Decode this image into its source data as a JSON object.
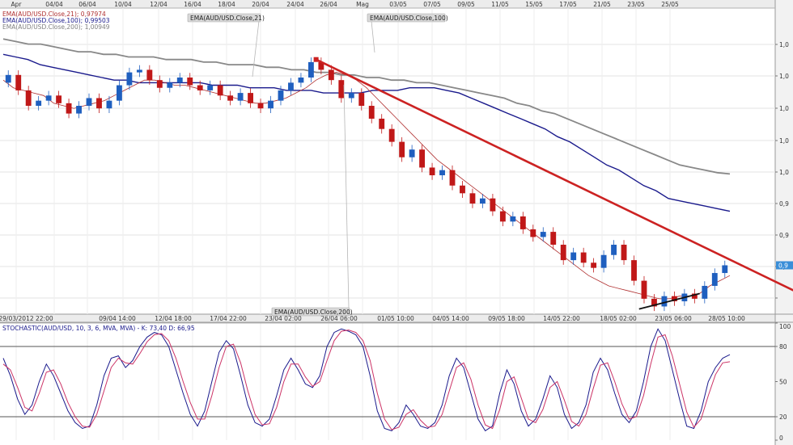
{
  "chart_data": [
    {
      "type": "candlestick",
      "symbol": "AUD/USD",
      "legend": [
        {
          "label": "EMA(AUD/USD.Close,21); 0,97974",
          "color": "#b03030"
        },
        {
          "label": "EMA(AUD/USD.Close,100); 0,99503",
          "color": "#1a1a8c"
        },
        {
          "label": "EMA(AUD/USD.Close,200); 1,00949",
          "color": "#808080"
        }
      ],
      "callouts": [
        "EMA(AUD/USD.Close,21)",
        "EMA(AUD/USD.Close,100)",
        "EMA(AUD/USD.Close,200)"
      ],
      "top_date_labels": [
        "Apr",
        "04/04",
        "06/04",
        "10/04",
        "12/04",
        "16/04",
        "18/04",
        "20/04",
        "24/04",
        "26/04",
        "Mag",
        "03/05",
        "07/05",
        "09/05",
        "11/05",
        "15/05",
        "17/05",
        "21/05",
        "23/05",
        "25/05"
      ],
      "bottom_date_labels": [
        "29/03/2012 22:00",
        "09/04 14:00",
        "12/04 18:00",
        "17/04 22:00",
        "23/04 02:00",
        "26/04 06:00",
        "01/05 10:00",
        "04/05 14:00",
        "09/05 18:00",
        "14/05 22:00",
        "18/05 02:00",
        "23/05 06:00",
        "28/05 10:00"
      ],
      "y_tick_labels": [
        "1,0",
        "1,0",
        "1,0",
        "1,0",
        "1,0",
        "0,9",
        "0,9",
        "0,9"
      ],
      "last_price_tag": "0,9",
      "ema": {
        "ema21": [
          1.046,
          1.043,
          1.042,
          1.041,
          1.04,
          1.037,
          1.036,
          1.035,
          1.036,
          1.037,
          1.038,
          1.04,
          1.042,
          1.044,
          1.046,
          1.046,
          1.045,
          1.044,
          1.044,
          1.043,
          1.042,
          1.041,
          1.04,
          1.039,
          1.038,
          1.037,
          1.037,
          1.038,
          1.039,
          1.041,
          1.043,
          1.046,
          1.048,
          1.049,
          1.048,
          1.046,
          1.043,
          1.039,
          1.035,
          1.031,
          1.027,
          1.023,
          1.019,
          1.015,
          1.012,
          1.009,
          1.006,
          1.003,
          1.0,
          0.997,
          0.994,
          0.991,
          0.988,
          0.985,
          0.982,
          0.979,
          0.976,
          0.973,
          0.97,
          0.968,
          0.966,
          0.965,
          0.964,
          0.963,
          0.962,
          0.961,
          0.961,
          0.962,
          0.962,
          0.963,
          0.966,
          0.968,
          0.97
        ],
        "ema100": [
          1.056,
          1.055,
          1.054,
          1.052,
          1.051,
          1.05,
          1.049,
          1.048,
          1.047,
          1.046,
          1.046,
          1.045,
          1.045,
          1.045,
          1.045,
          1.045,
          1.045,
          1.044,
          1.044,
          1.044,
          1.043,
          1.043,
          1.043,
          1.042,
          1.042,
          1.042,
          1.041,
          1.041,
          1.041,
          1.041,
          1.042,
          1.042,
          1.042,
          1.043,
          1.043,
          1.043,
          1.042,
          1.041,
          1.039,
          1.037,
          1.035,
          1.033,
          1.031,
          1.029,
          1.027,
          1.024,
          1.022,
          1.019,
          1.016,
          1.013,
          1.011,
          1.008,
          1.005,
          1.003,
          1.0,
          0.999,
          0.998,
          0.997,
          0.996,
          0.995
        ],
        "ema200": [
          1.062,
          1.061,
          1.06,
          1.06,
          1.059,
          1.058,
          1.057,
          1.057,
          1.056,
          1.056,
          1.055,
          1.055,
          1.055,
          1.054,
          1.054,
          1.054,
          1.053,
          1.053,
          1.052,
          1.052,
          1.052,
          1.051,
          1.051,
          1.05,
          1.05,
          1.049,
          1.049,
          1.048,
          1.048,
          1.047,
          1.047,
          1.046,
          1.046,
          1.045,
          1.045,
          1.044,
          1.043,
          1.042,
          1.041,
          1.04,
          1.039,
          1.037,
          1.036,
          1.034,
          1.033,
          1.031,
          1.029,
          1.027,
          1.025,
          1.023,
          1.021,
          1.019,
          1.017,
          1.015,
          1.013,
          1.012,
          1.011,
          1.01,
          1.0095
        ]
      },
      "candles": [
        {
          "o": 1.045,
          "c": 1.048
        },
        {
          "o": 1.048,
          "c": 1.042
        },
        {
          "o": 1.042,
          "c": 1.036
        },
        {
          "o": 1.036,
          "c": 1.038
        },
        {
          "o": 1.038,
          "c": 1.04
        },
        {
          "o": 1.04,
          "c": 1.037
        },
        {
          "o": 1.037,
          "c": 1.033
        },
        {
          "o": 1.033,
          "c": 1.036
        },
        {
          "o": 1.036,
          "c": 1.039
        },
        {
          "o": 1.039,
          "c": 1.035
        },
        {
          "o": 1.035,
          "c": 1.038
        },
        {
          "o": 1.038,
          "c": 1.044
        },
        {
          "o": 1.044,
          "c": 1.049
        },
        {
          "o": 1.049,
          "c": 1.05
        },
        {
          "o": 1.05,
          "c": 1.046
        },
        {
          "o": 1.046,
          "c": 1.043
        },
        {
          "o": 1.043,
          "c": 1.045
        },
        {
          "o": 1.045,
          "c": 1.047
        },
        {
          "o": 1.047,
          "c": 1.044
        },
        {
          "o": 1.044,
          "c": 1.042
        },
        {
          "o": 1.042,
          "c": 1.044
        },
        {
          "o": 1.044,
          "c": 1.04
        },
        {
          "o": 1.04,
          "c": 1.038
        },
        {
          "o": 1.038,
          "c": 1.041
        },
        {
          "o": 1.041,
          "c": 1.037
        },
        {
          "o": 1.037,
          "c": 1.035
        },
        {
          "o": 1.035,
          "c": 1.038
        },
        {
          "o": 1.038,
          "c": 1.042
        },
        {
          "o": 1.042,
          "c": 1.045
        },
        {
          "o": 1.045,
          "c": 1.047
        },
        {
          "o": 1.047,
          "c": 1.053
        },
        {
          "o": 1.053,
          "c": 1.05
        },
        {
          "o": 1.05,
          "c": 1.046
        },
        {
          "o": 1.046,
          "c": 1.039
        },
        {
          "o": 1.039,
          "c": 1.041
        },
        {
          "o": 1.041,
          "c": 1.036
        },
        {
          "o": 1.036,
          "c": 1.031
        },
        {
          "o": 1.031,
          "c": 1.027
        },
        {
          "o": 1.027,
          "c": 1.022
        },
        {
          "o": 1.022,
          "c": 1.016
        },
        {
          "o": 1.016,
          "c": 1.019
        },
        {
          "o": 1.019,
          "c": 1.012
        },
        {
          "o": 1.012,
          "c": 1.009
        },
        {
          "o": 1.009,
          "c": 1.011
        },
        {
          "o": 1.011,
          "c": 1.005
        },
        {
          "o": 1.005,
          "c": 1.002
        },
        {
          "o": 1.002,
          "c": 0.998
        },
        {
          "o": 0.998,
          "c": 1.0
        },
        {
          "o": 1.0,
          "c": 0.995
        },
        {
          "o": 0.995,
          "c": 0.991
        },
        {
          "o": 0.991,
          "c": 0.993
        },
        {
          "o": 0.993,
          "c": 0.988
        },
        {
          "o": 0.988,
          "c": 0.985
        },
        {
          "o": 0.985,
          "c": 0.987
        },
        {
          "o": 0.987,
          "c": 0.982
        },
        {
          "o": 0.982,
          "c": 0.976
        },
        {
          "o": 0.976,
          "c": 0.979
        },
        {
          "o": 0.979,
          "c": 0.975
        },
        {
          "o": 0.975,
          "c": 0.973
        },
        {
          "o": 0.973,
          "c": 0.978
        },
        {
          "o": 0.978,
          "c": 0.982
        },
        {
          "o": 0.982,
          "c": 0.976
        },
        {
          "o": 0.976,
          "c": 0.968
        },
        {
          "o": 0.968,
          "c": 0.961
        },
        {
          "o": 0.961,
          "c": 0.958
        },
        {
          "o": 0.958,
          "c": 0.962
        },
        {
          "o": 0.962,
          "c": 0.96
        },
        {
          "o": 0.96,
          "c": 0.963
        },
        {
          "o": 0.963,
          "c": 0.961
        },
        {
          "o": 0.961,
          "c": 0.966
        },
        {
          "o": 0.966,
          "c": 0.971
        },
        {
          "o": 0.971,
          "c": 0.974
        }
      ],
      "trendlines": [
        {
          "color": "#cc2222",
          "from": {
            "i": 30.5,
            "v": 1.054
          },
          "to": {
            "i": 79.5,
            "v": 0.961
          }
        },
        {
          "color": "#111111",
          "from": {
            "i": 62.5,
            "v": 0.957
          },
          "to": {
            "i": 68.5,
            "v": 0.963
          }
        }
      ],
      "ylim": [
        0.955,
        1.074
      ]
    },
    {
      "type": "line",
      "title": "STOCHASTIC(AUD/USD, 10, 3, 6, MVA, MVA) - K: 73,40  D: 66,95",
      "y_tick_labels": [
        "100",
        "80",
        "50",
        "20",
        "0"
      ],
      "ylim": [
        0,
        100
      ],
      "levels": [
        80,
        20
      ],
      "series": [
        {
          "name": "K",
          "color": "#1a1a8c",
          "values": [
            70,
            55,
            35,
            22,
            30,
            50,
            65,
            55,
            40,
            25,
            15,
            10,
            12,
            30,
            55,
            70,
            72,
            62,
            68,
            80,
            88,
            92,
            90,
            80,
            60,
            40,
            22,
            12,
            25,
            50,
            75,
            85,
            78,
            55,
            30,
            15,
            12,
            18,
            38,
            60,
            70,
            60,
            48,
            45,
            55,
            80,
            92,
            95,
            93,
            90,
            80,
            55,
            25,
            10,
            8,
            15,
            30,
            22,
            12,
            10,
            15,
            30,
            55,
            70,
            62,
            40,
            18,
            8,
            12,
            40,
            60,
            48,
            25,
            12,
            18,
            35,
            55,
            45,
            22,
            10,
            15,
            30,
            58,
            70,
            60,
            40,
            22,
            15,
            25,
            50,
            80,
            95,
            85,
            60,
            35,
            12,
            10,
            25,
            50,
            62,
            70,
            73
          ]
        },
        {
          "name": "D",
          "color": "#cc3366",
          "values": [
            65,
            60,
            45,
            28,
            25,
            40,
            58,
            60,
            48,
            32,
            20,
            12,
            11,
            22,
            42,
            62,
            70,
            66,
            65,
            74,
            84,
            90,
            91,
            85,
            70,
            50,
            32,
            18,
            18,
            38,
            62,
            80,
            82,
            66,
            42,
            22,
            13,
            14,
            28,
            50,
            65,
            65,
            54,
            46,
            50,
            68,
            85,
            93,
            94,
            92,
            85,
            68,
            40,
            18,
            9,
            11,
            22,
            26,
            17,
            11,
            12,
            22,
            42,
            62,
            66,
            52,
            30,
            13,
            10,
            26,
            50,
            54,
            36,
            18,
            15,
            26,
            45,
            50,
            34,
            16,
            12,
            22,
            44,
            64,
            66,
            50,
            31,
            18,
            20,
            38,
            65,
            88,
            90,
            72,
            48,
            24,
            11,
            18,
            38,
            56,
            66,
            67
          ]
        }
      ]
    }
  ]
}
